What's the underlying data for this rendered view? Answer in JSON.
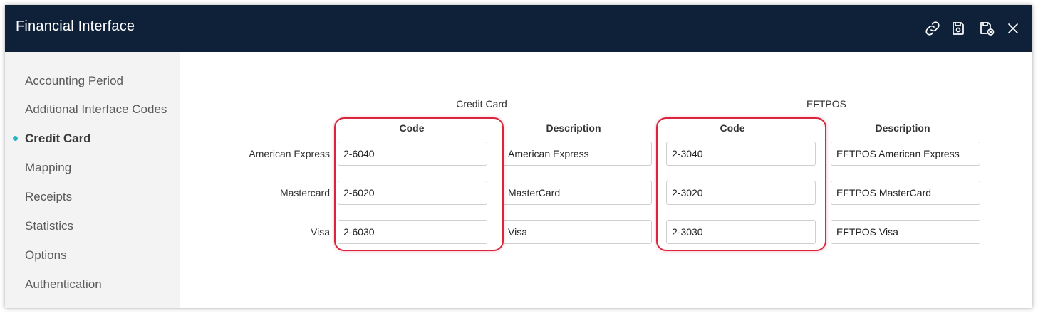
{
  "window": {
    "title": "Financial Interface"
  },
  "toolbar": {
    "icons": [
      "link-icon",
      "save-icon",
      "save-close-icon",
      "close-icon"
    ]
  },
  "sidebar": {
    "items": [
      {
        "label": "Accounting Period"
      },
      {
        "label": "Additional Interface Codes"
      },
      {
        "label": "Credit Card",
        "active": true
      },
      {
        "label": "Mapping"
      },
      {
        "label": "Receipts"
      },
      {
        "label": "Statistics"
      },
      {
        "label": "Options"
      },
      {
        "label": "Authentication"
      }
    ],
    "active_color": "#29b6c6"
  },
  "main": {
    "groups": {
      "credit_card": "Credit Card",
      "eftpos": "EFTPOS"
    },
    "headers": {
      "code": "Code",
      "description": "Description"
    },
    "rows": [
      {
        "label": "American Express",
        "cc_code": "2-6040",
        "cc_desc": "American Express",
        "ef_code": "2-3040",
        "ef_desc": "EFTPOS American Express"
      },
      {
        "label": "Mastercard",
        "cc_code": "2-6020",
        "cc_desc": "MasterCard",
        "ef_code": "2-3020",
        "ef_desc": "EFTPOS MasterCard"
      },
      {
        "label": "Visa",
        "cc_code": "2-6030",
        "cc_desc": "Visa",
        "ef_code": "2-3030",
        "ef_desc": "EFTPOS Visa"
      }
    ]
  },
  "colors": {
    "titlebar": "#0f2039",
    "highlight": "#d9263e",
    "sidebar_bg": "#f3f3f3"
  }
}
